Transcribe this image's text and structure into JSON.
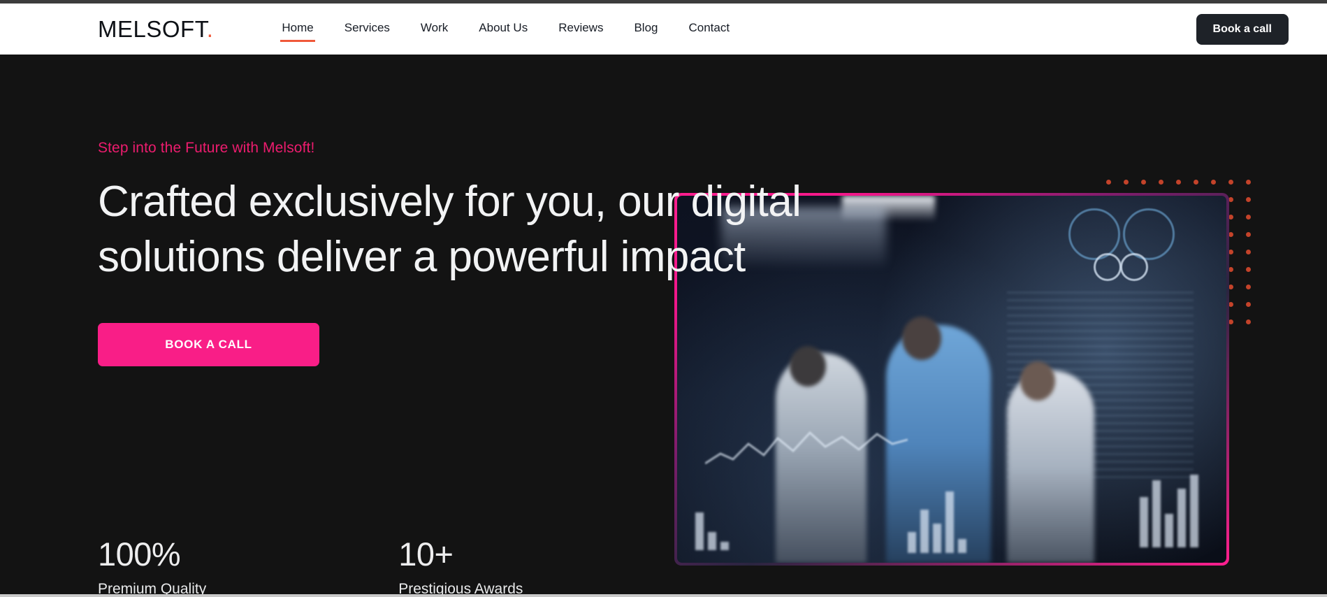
{
  "brand": {
    "name": "MELSOFT",
    "dot": "."
  },
  "nav": {
    "items": [
      {
        "label": "Home",
        "active": true
      },
      {
        "label": "Services",
        "active": false
      },
      {
        "label": "Work",
        "active": false
      },
      {
        "label": "About Us",
        "active": false
      },
      {
        "label": "Reviews",
        "active": false
      },
      {
        "label": "Blog",
        "active": false
      },
      {
        "label": "Contact",
        "active": false
      }
    ],
    "cta_label": "Book a call",
    "active_underline_color": "#f0593a"
  },
  "hero": {
    "eyebrow": "Step into the Future with Melsoft!",
    "eyebrow_color": "#ec1c6e",
    "headline": "Crafted exclusively for you, our digital solutions deliver a powerful impact",
    "cta_label": "BOOK A CALL",
    "cta_color": "#f91e87",
    "background_color": "#131313",
    "image_alt": "Team of professionals in a dark office with data visualisation overlays",
    "image_border_color": "#ff1f8f",
    "dot_grid": {
      "columns": 9,
      "rows": 9,
      "color": "#c4432a"
    }
  },
  "stats": [
    {
      "value": "100%",
      "label": "Premium Quality"
    },
    {
      "value": "10+",
      "label": "Prestigious Awards"
    }
  ]
}
